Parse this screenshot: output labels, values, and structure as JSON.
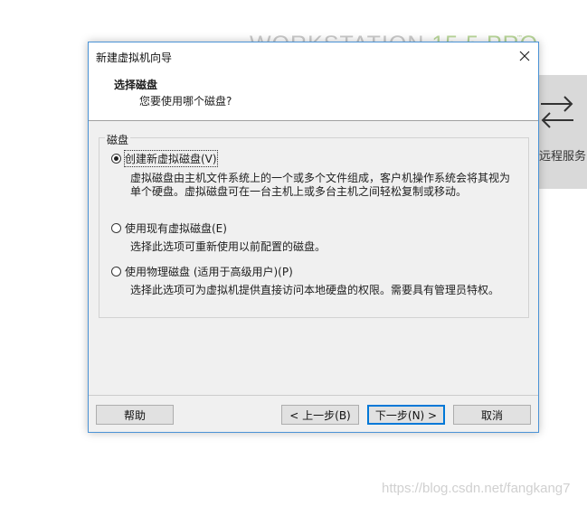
{
  "background": {
    "brand_text": "WORKSTATION",
    "brand_version": "15.5 PRO",
    "brand_tm": "™",
    "side_panel_label": "远程服务",
    "side_panel_icon": "swap-arrows-icon"
  },
  "dialog": {
    "window_title": "新建虚拟机向导",
    "header_title": "选择磁盘",
    "header_subtitle": "您要使用哪个磁盘?",
    "group_label": "磁盘",
    "options": [
      {
        "label": "创建新虚拟磁盘(V)",
        "selected": true,
        "description": [
          "虚拟磁盘由主机文件系统上的一个或多个文件组成，客户机操作系统会将其视为",
          "单个硬盘。虚拟磁盘可在一台主机上或多台主机之间轻松复制或移动。"
        ]
      },
      {
        "label": "使用现有虚拟磁盘(E)",
        "selected": false,
        "description": [
          "选择此选项可重新使用以前配置的磁盘。"
        ]
      },
      {
        "label": "使用物理磁盘 (适用于高级用户)(P)",
        "selected": false,
        "description": [
          "选择此选项可为虚拟机提供直接访问本地硬盘的权限。需要具有管理员特权。"
        ]
      }
    ],
    "buttons": {
      "help": "帮助",
      "back": "< 上一步(B)",
      "next": "下一步(N) >",
      "cancel": "取消"
    },
    "close_icon": "close-icon"
  },
  "watermark": "https://blog.csdn.net/fangkang7"
}
